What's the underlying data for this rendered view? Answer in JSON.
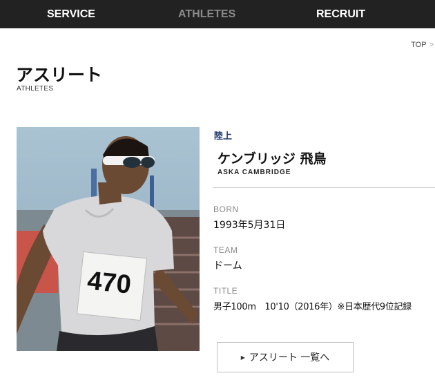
{
  "nav": {
    "service": "SERVICE",
    "athletes": "ATHLETES",
    "recruit": "RECRUIT"
  },
  "breadcrumb": {
    "top": "TOP",
    "separator": ">"
  },
  "page": {
    "title": "アスリート",
    "subtitle": "ATHLETES"
  },
  "athlete": {
    "sport": "陸上",
    "name_jp": "ケンブリッジ 飛鳥",
    "name_en": "ASKA CAMBRIDGE",
    "bib": "470",
    "fields": {
      "born_label": "BORN",
      "born_value": "1993年5月31日",
      "team_label": "TEAM",
      "team_value": "ドーム",
      "title_label": "TITLE",
      "title_value": "男子100m　10'10（2016年）※日本歴代9位記録"
    }
  },
  "list_button": {
    "label": "アスリート 一覧へ"
  },
  "colors": {
    "nav_bg": "#222222",
    "nav_active": "#8a8a8a",
    "sport": "#1f3566"
  },
  "icons": {
    "button_arrow": "right-triangle-icon"
  }
}
